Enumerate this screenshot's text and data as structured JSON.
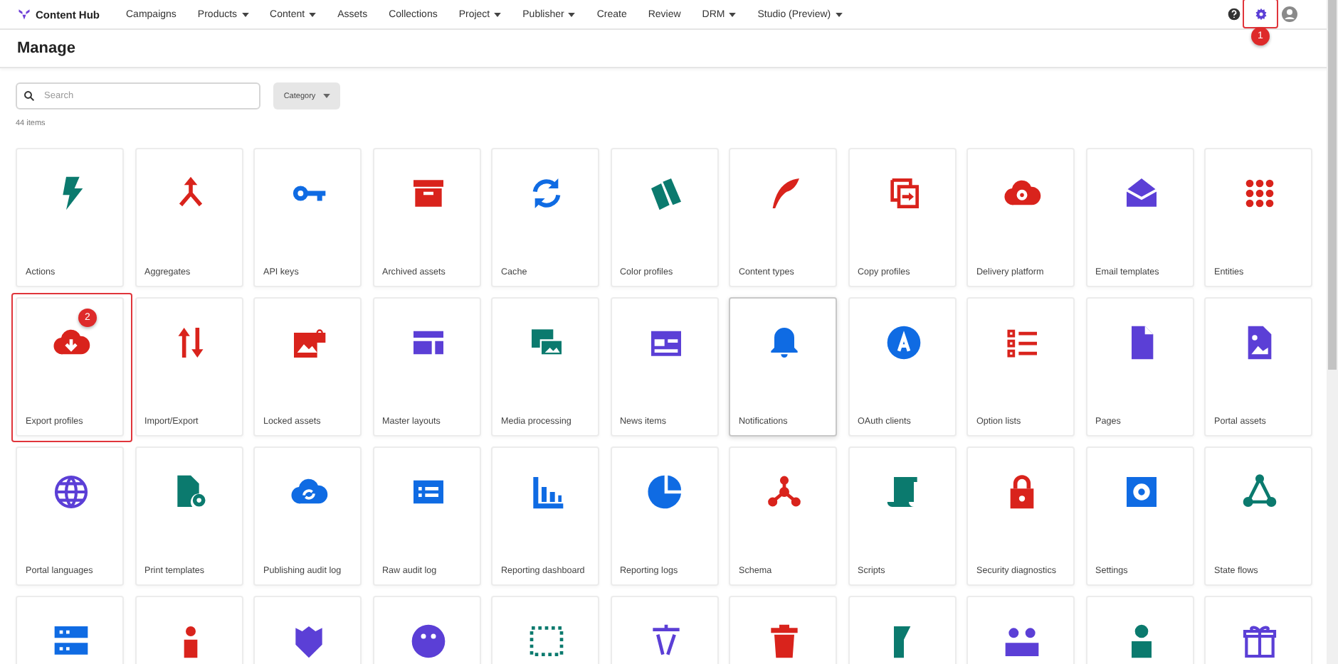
{
  "nav": {
    "brand": "Content Hub",
    "items": [
      {
        "label": "Campaigns",
        "dropdown": false
      },
      {
        "label": "Products",
        "dropdown": true
      },
      {
        "label": "Content",
        "dropdown": true
      },
      {
        "label": "Assets",
        "dropdown": false
      },
      {
        "label": "Collections",
        "dropdown": false
      },
      {
        "label": "Project",
        "dropdown": true
      },
      {
        "label": "Publisher",
        "dropdown": true
      },
      {
        "label": "Create",
        "dropdown": false
      },
      {
        "label": "Review",
        "dropdown": false
      },
      {
        "label": "DRM",
        "dropdown": true
      },
      {
        "label": "Studio (Preview)",
        "dropdown": true
      }
    ],
    "settings_callout": "1"
  },
  "page_title": "Manage",
  "search": {
    "placeholder": "Search"
  },
  "category_filter": "Category",
  "count": "44 items",
  "tiles": [
    {
      "kind": "full",
      "label": "Actions",
      "hovered": false
    },
    {
      "kind": "full",
      "label": "Aggregates",
      "hovered": false
    },
    {
      "kind": "full",
      "label": "API keys",
      "hovered": false
    },
    {
      "kind": "full",
      "label": "Archived assets",
      "hovered": false
    },
    {
      "kind": "full",
      "label": "Cache",
      "hovered": false
    },
    {
      "kind": "full",
      "label": "Color profiles",
      "hovered": false
    },
    {
      "kind": "full",
      "label": "Content types",
      "hovered": false
    },
    {
      "kind": "full",
      "label": "Copy profiles",
      "hovered": false
    },
    {
      "kind": "full",
      "label": "Delivery platform",
      "hovered": false
    },
    {
      "kind": "full",
      "label": "Email templates",
      "hovered": false
    },
    {
      "kind": "full",
      "label": "Entities",
      "hovered": false
    },
    {
      "kind": "full",
      "label": "Export profiles",
      "hovered": false,
      "callout": "2"
    },
    {
      "kind": "full",
      "label": "Import/Export",
      "hovered": false
    },
    {
      "kind": "full",
      "label": "Locked assets",
      "hovered": false
    },
    {
      "kind": "full",
      "label": "Master layouts",
      "hovered": false
    },
    {
      "kind": "full",
      "label": "Media processing",
      "hovered": false
    },
    {
      "kind": "full",
      "label": "News items",
      "hovered": false
    },
    {
      "kind": "full",
      "label": "Notifications",
      "hovered": true
    },
    {
      "kind": "full",
      "label": "OAuth clients",
      "hovered": false
    },
    {
      "kind": "full",
      "label": "Option lists",
      "hovered": false
    },
    {
      "kind": "full",
      "label": "Pages",
      "hovered": false
    },
    {
      "kind": "full",
      "label": "Portal assets",
      "hovered": false
    },
    {
      "kind": "full",
      "label": "Portal languages",
      "hovered": false
    },
    {
      "kind": "full",
      "label": "Print templates",
      "hovered": false
    },
    {
      "kind": "full",
      "label": "Publishing audit log",
      "hovered": false
    },
    {
      "kind": "full",
      "label": "Raw audit log",
      "hovered": false
    },
    {
      "kind": "full",
      "label": "Reporting dashboard",
      "hovered": false
    },
    {
      "kind": "full",
      "label": "Reporting logs",
      "hovered": false
    },
    {
      "kind": "full",
      "label": "Schema",
      "hovered": false
    },
    {
      "kind": "full",
      "label": "Scripts",
      "hovered": false
    },
    {
      "kind": "full",
      "label": "Security diagnostics",
      "hovered": false
    },
    {
      "kind": "full",
      "label": "Settings",
      "hovered": false
    },
    {
      "kind": "full",
      "label": "State flows",
      "hovered": false
    },
    {
      "kind": "cut",
      "hovered": false
    },
    {
      "kind": "cut",
      "hovered": false
    },
    {
      "kind": "cut",
      "hovered": false
    },
    {
      "kind": "cut",
      "hovered": false
    },
    {
      "kind": "cut",
      "hovered": false
    },
    {
      "kind": "cut",
      "hovered": false
    },
    {
      "kind": "cut",
      "hovered": false
    },
    {
      "kind": "cut",
      "hovered": false
    },
    {
      "kind": "cut",
      "hovered": false
    },
    {
      "kind": "cut",
      "hovered": false
    },
    {
      "kind": "cut",
      "hovered": false
    }
  ]
}
